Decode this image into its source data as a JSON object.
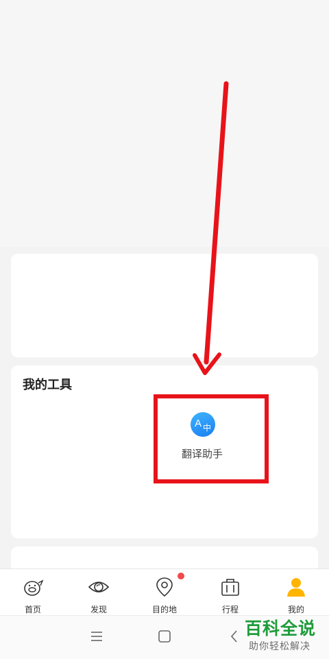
{
  "tools_section": {
    "title": "我的工具",
    "items": [
      {
        "label": "翻译助手",
        "icon": "translate-icon",
        "icon_color": "#1a7ff0"
      }
    ]
  },
  "tabbar": {
    "items": [
      {
        "label": "首页",
        "icon": "pig-icon"
      },
      {
        "label": "发现",
        "icon": "eye-icon",
        "has_badge": true
      },
      {
        "label": "目的地",
        "icon": "location-pin-icon"
      },
      {
        "label": "行程",
        "icon": "suitcase-icon"
      },
      {
        "label": "我的",
        "icon": "user-icon",
        "active_color": "#ffb400"
      }
    ]
  },
  "system_nav": {
    "items": [
      "menu-icon",
      "home-square-icon",
      "back-icon"
    ]
  },
  "annotation": {
    "color": "#e8131a"
  },
  "watermark": {
    "title": "百科全说",
    "subtitle": "助你轻松解决"
  }
}
